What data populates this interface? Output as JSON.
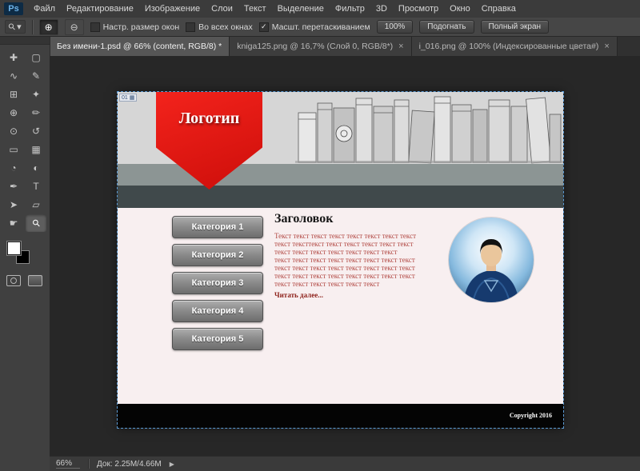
{
  "menubar": {
    "logo": "Ps",
    "items": [
      "Файл",
      "Редактирование",
      "Изображение",
      "Слои",
      "Текст",
      "Выделение",
      "Фильтр",
      "3D",
      "Просмотр",
      "Окно",
      "Справка"
    ]
  },
  "options": {
    "tool_glyph": "⚲",
    "dropdown_glyph": "▾",
    "zoom_in_glyph": "⊕",
    "zoom_out_glyph": "⊖",
    "checkbox1": "Настр. размер окон",
    "checkbox2": "Во всех окнах",
    "checkbox3": "Масшт. перетаскиванием",
    "check_glyph": "✓",
    "zoom_button": "100%",
    "fit_button": "Подогнать",
    "fullscreen_button": "Полный экран"
  },
  "tabs": {
    "tab1": "Без имени-1.psd @ 66% (content, RGB/8) *",
    "tab2": "kniga125.png @ 16,7% (Слой 0, RGB/8*)",
    "tab3": "i_016.png @ 100% (Индексированные цвета#)",
    "close_glyph": "×"
  },
  "tools": [
    {
      "name": "move-tool",
      "glyph": "✚"
    },
    {
      "name": "marquee-tool",
      "glyph": "▢"
    },
    {
      "name": "lasso-tool",
      "glyph": "∿"
    },
    {
      "name": "quick-select-tool",
      "glyph": "✎"
    },
    {
      "name": "crop-tool",
      "glyph": "⊞"
    },
    {
      "name": "eyedropper-tool",
      "glyph": "✦"
    },
    {
      "name": "healing-brush-tool",
      "glyph": "⊕"
    },
    {
      "name": "brush-tool",
      "glyph": "✏"
    },
    {
      "name": "clone-stamp-tool",
      "glyph": "⊙"
    },
    {
      "name": "history-brush-tool",
      "glyph": "↺"
    },
    {
      "name": "eraser-tool",
      "glyph": "▭"
    },
    {
      "name": "gradient-tool",
      "glyph": "▦"
    },
    {
      "name": "blur-tool",
      "glyph": "◔"
    },
    {
      "name": "dodge-tool",
      "glyph": "◐"
    },
    {
      "name": "pen-tool",
      "glyph": "✒"
    },
    {
      "name": "type-tool",
      "glyph": "T"
    },
    {
      "name": "path-select-tool",
      "glyph": "➤"
    },
    {
      "name": "shape-tool",
      "glyph": "▱"
    },
    {
      "name": "hand-tool",
      "glyph": "☛"
    },
    {
      "name": "zoom-tool",
      "glyph": "⚲"
    }
  ],
  "document": {
    "slice_badge": "01",
    "slice_icon": "▦",
    "logo": "Логотип",
    "buttons": [
      "Категория 1",
      "Категория 2",
      "Категория 3",
      "Категория 4",
      "Категория 5"
    ],
    "heading": "Заголовок",
    "lines": [
      "Текст текст текст текст текст текст текст текст",
      "текст тексттекст текст текст текст текст текст",
      "текст текст текст текст текст текст текст",
      "текст текст текст текст текст текст текст текст",
      "текст текст текст текст текст текст текст текст",
      "текст текст текст текст текст текст текст текст",
      "текст текст текст текст текст текст"
    ],
    "read_more": "Читать далее...",
    "footer": "Copyright 2016"
  },
  "statusbar": {
    "zoom": "66%",
    "doc": "Док: 2.25M/4.66M",
    "arrow": "▶"
  }
}
